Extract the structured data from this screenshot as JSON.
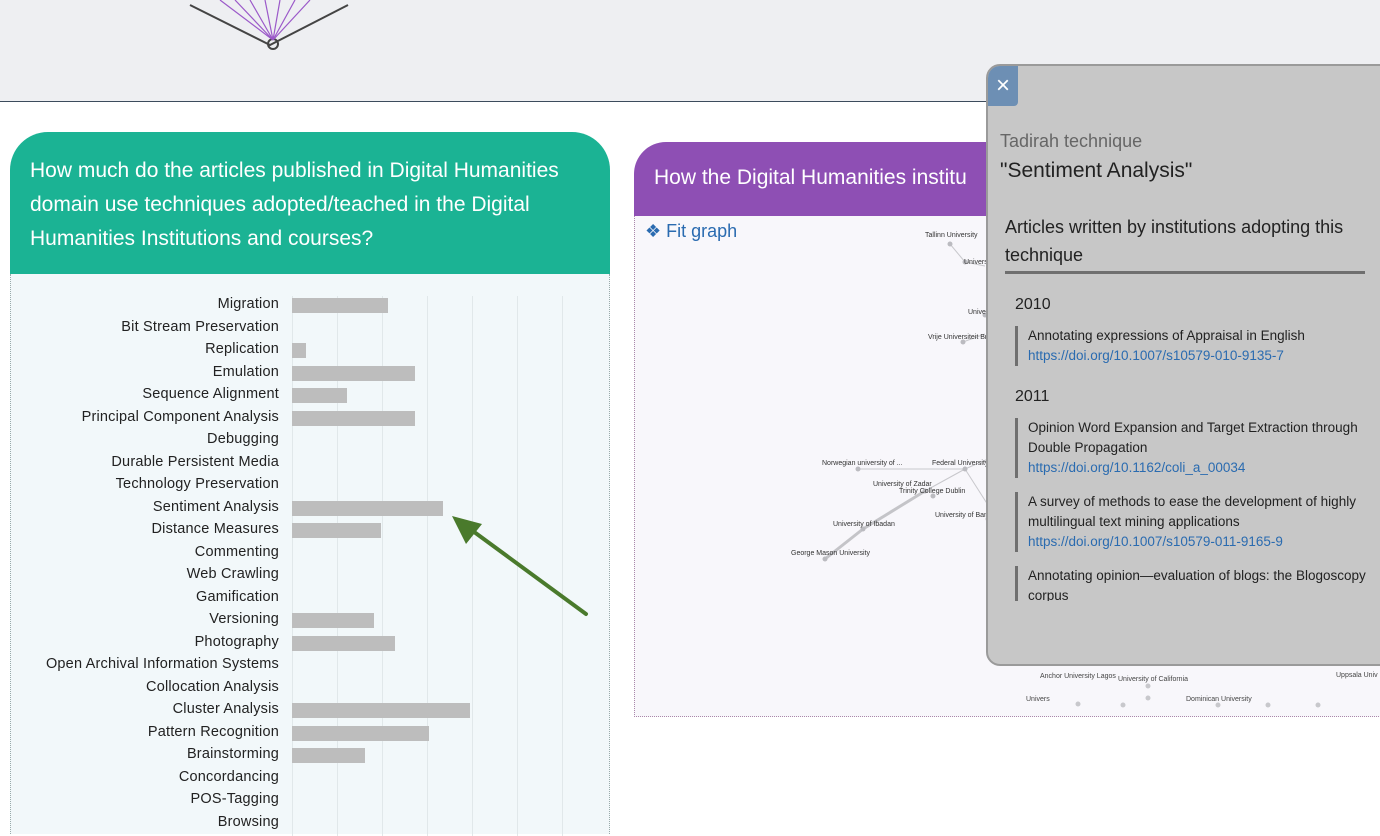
{
  "left_card": {
    "title": "How much do the articles published in Digital Humanities domain use techniques adopted/teached in the Digital Humanities Institutions and courses?"
  },
  "chart_data": {
    "type": "bar",
    "orientation": "horizontal",
    "categories": [
      "Migration",
      "Bit Stream Preservation",
      "Replication",
      "Emulation",
      "Sequence Alignment",
      "Principal Component Analysis",
      "Debugging",
      "Durable Persistent Media",
      "Technology Preservation",
      "Sentiment Analysis",
      "Distance Measures",
      "Commenting",
      "Web Crawling",
      "Gamification",
      "Versioning",
      "Photography",
      "Open Archival Information Systems",
      "Collocation Analysis",
      "Cluster Analysis",
      "Pattern Recognition",
      "Brainstorming",
      "Concordancing",
      "POS-Tagging",
      "Browsing"
    ],
    "values": [
      7,
      0,
      1,
      9,
      4,
      9,
      0,
      0,
      0,
      11,
      6.5,
      0,
      0,
      0,
      6,
      7.5,
      0,
      0,
      13,
      10,
      5.3,
      0,
      0,
      0
    ],
    "grid": true,
    "bar_color": "#bdbdbd",
    "annotation": "green arrow pointing to Sentiment Analysis"
  },
  "mid_card": {
    "title": "How the Digital Humanities institu",
    "fit_graph_label": "❖ Fit graph",
    "nodes": [
      "Tallinn University",
      "Univers",
      "Unive",
      "Vrije Universiteit Bru",
      "Norwegian university of ...",
      "Federal University o",
      "University of Zadar",
      "Trinity College Dublin",
      "University of Bam",
      "University of Ibadan",
      "George Mason University"
    ]
  },
  "popup": {
    "close_label": "×",
    "label": "Tadirah technique",
    "term": "\"Sentiment Analysis\"",
    "section_title": "Articles written by institutions adopting this technique",
    "years": [
      {
        "year": "2010",
        "articles": [
          {
            "title": "Annotating expressions of Appraisal in English",
            "doi": "https://doi.org/10.1007/s10579-010-9135-7"
          }
        ]
      },
      {
        "year": "2011",
        "articles": [
          {
            "title": "Opinion Word Expansion and Target Extraction through Double Propagation",
            "doi": "https://doi.org/10.1162/coli_a_00034"
          },
          {
            "title": "A survey of methods to ease the development of highly multilingual text mining applications",
            "doi": "https://doi.org/10.1007/s10579-011-9165-9"
          },
          {
            "title": "Annotating opinion—evaluation of blogs: the Blogoscopy corpus",
            "doi": ""
          }
        ]
      }
    ]
  },
  "bottom_labels": [
    "Anchor University Lagos",
    "University of California",
    "Uppsala Univ",
    "Dominican University",
    "Univers"
  ]
}
